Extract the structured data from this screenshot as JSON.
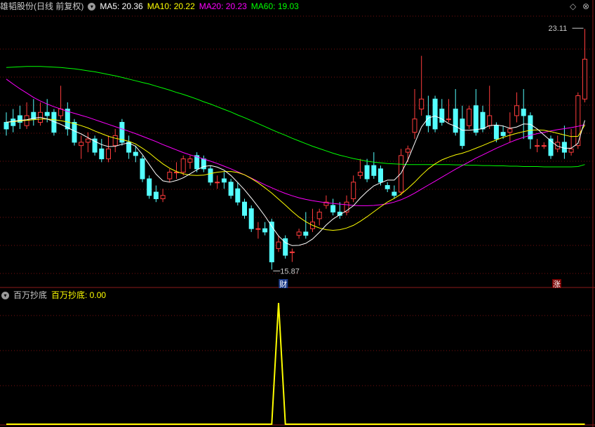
{
  "header": {
    "stock_name": "雄韬股份(日线 前复权)",
    "ma5_label": "MA5: 20.36",
    "ma10_label": "MA10: 20.22",
    "ma20_label": "MA20: 20.23",
    "ma60_label": "MA60: 19.03",
    "colors": {
      "ma5": "#ffffff",
      "ma10": "#ffff00",
      "ma20": "#ff00ff",
      "ma60": "#00ff00"
    }
  },
  "indicator": {
    "name": "百万抄底",
    "value_label": "百万抄底: 0.00"
  },
  "annotations": {
    "high_label": "23.11",
    "low_label": "15.87",
    "cai_marker": "财",
    "zhang_marker": "涨"
  },
  "controls": {
    "diamond": "◇",
    "close": "⊗"
  },
  "chart_data": [
    {
      "type": "candlestick",
      "y_range": [
        15.5,
        23.6
      ],
      "max_price": 23.11,
      "min_price": 15.87,
      "up_color": "#ff3c3c",
      "down_color": "#54ffff",
      "candles": [
        [
          20.3,
          20.1,
          20.6,
          19.9
        ],
        [
          20.4,
          20.2,
          20.7,
          20.0
        ],
        [
          20.5,
          20.3,
          20.8,
          20.1
        ],
        [
          20.2,
          20.5,
          20.9,
          20.1
        ],
        [
          20.6,
          20.4,
          21.0,
          20.2
        ],
        [
          20.3,
          20.6,
          20.9,
          20.2
        ],
        [
          20.6,
          20.5,
          21.0,
          20.3
        ],
        [
          20.6,
          20.0,
          20.7,
          19.9
        ],
        [
          20.5,
          20.7,
          21.4,
          20.4
        ],
        [
          20.7,
          20.1,
          20.9,
          19.9
        ],
        [
          20.3,
          19.7,
          20.4,
          19.6
        ],
        [
          19.6,
          19.7,
          19.9,
          19.2
        ],
        [
          19.7,
          19.8,
          20.0,
          19.4
        ],
        [
          19.8,
          19.4,
          19.9,
          19.3
        ],
        [
          19.5,
          19.2,
          19.8,
          19.1
        ],
        [
          19.2,
          19.5,
          19.9,
          19.1
        ],
        [
          19.6,
          19.9,
          20.1,
          19.4
        ],
        [
          20.3,
          19.7,
          20.4,
          19.6
        ],
        [
          19.7,
          19.4,
          19.9,
          19.2
        ],
        [
          19.4,
          19.3,
          19.6,
          19.1
        ],
        [
          19.2,
          18.6,
          19.3,
          18.5
        ],
        [
          18.6,
          18.1,
          18.7,
          18.0
        ],
        [
          18.2,
          18.0,
          18.4,
          17.9
        ],
        [
          18.0,
          18.1,
          18.3,
          17.9
        ],
        [
          18.6,
          18.8,
          18.9,
          18.5
        ],
        [
          18.8,
          18.8,
          19.1,
          18.6
        ],
        [
          18.8,
          19.2,
          19.3,
          18.7
        ],
        [
          19.1,
          19.2,
          19.3,
          18.9
        ],
        [
          19.3,
          18.9,
          19.4,
          18.8
        ],
        [
          19.2,
          18.9,
          19.3,
          18.8
        ],
        [
          18.9,
          18.5,
          19.0,
          18.4
        ],
        [
          18.5,
          18.5,
          18.7,
          18.3
        ],
        [
          18.6,
          18.5,
          18.8,
          18.3
        ],
        [
          18.5,
          18.1,
          18.6,
          18.0
        ],
        [
          18.3,
          17.9,
          18.5,
          17.8
        ],
        [
          17.9,
          17.5,
          18.0,
          17.4
        ],
        [
          17.7,
          17.1,
          17.8,
          17.0
        ],
        [
          17.1,
          17.1,
          17.3,
          16.8
        ],
        [
          17.1,
          17.0,
          17.3,
          16.9
        ],
        [
          17.3,
          16.1,
          17.4,
          15.87
        ],
        [
          16.5,
          16.7,
          16.9,
          16.4
        ],
        [
          16.8,
          16.3,
          16.9,
          16.2
        ],
        [
          16.4,
          16.4,
          16.5,
          16.1
        ],
        [
          16.9,
          17.0,
          17.1,
          16.8
        ],
        [
          17.0,
          16.9,
          17.6,
          16.8
        ],
        [
          17.1,
          17.3,
          17.7,
          17.0
        ],
        [
          17.4,
          17.6,
          17.7,
          17.2
        ],
        [
          17.8,
          17.9,
          18.1,
          17.7
        ],
        [
          17.8,
          17.6,
          18.0,
          17.5
        ],
        [
          17.6,
          17.5,
          17.9,
          17.4
        ],
        [
          17.6,
          17.9,
          18.1,
          17.5
        ],
        [
          18.0,
          18.5,
          18.7,
          17.9
        ],
        [
          18.7,
          18.8,
          19.2,
          18.6
        ],
        [
          19.0,
          18.6,
          19.2,
          18.5
        ],
        [
          19.0,
          18.7,
          19.4,
          18.6
        ],
        [
          18.9,
          18.5,
          19.0,
          18.4
        ],
        [
          18.4,
          18.3,
          18.5,
          18.2
        ],
        [
          18.2,
          18.1,
          18.4,
          18.0
        ],
        [
          18.2,
          19.3,
          19.5,
          18.1
        ],
        [
          19.4,
          19.5,
          19.6,
          19.1
        ],
        [
          20.0,
          20.4,
          21.3,
          19.8
        ],
        [
          20.7,
          21.0,
          22.3,
          20.5
        ],
        [
          20.5,
          20.2,
          21.1,
          20.0
        ],
        [
          21.0,
          20.1,
          21.1,
          20.0
        ],
        [
          20.7,
          20.3,
          21.0,
          20.2
        ],
        [
          20.4,
          20.4,
          21.0,
          20.3
        ],
        [
          20.7,
          20.0,
          21.3,
          19.9
        ],
        [
          20.4,
          19.6,
          20.8,
          19.5
        ],
        [
          20.2,
          20.7,
          20.8,
          20.1
        ],
        [
          20.8,
          20.0,
          21.3,
          19.9
        ],
        [
          20.6,
          20.1,
          20.8,
          20.0
        ],
        [
          20.2,
          20.5,
          21.4,
          20.1
        ],
        [
          20.2,
          19.8,
          20.3,
          19.7
        ],
        [
          20.0,
          19.9,
          20.2,
          19.8
        ],
        [
          20.0,
          20.1,
          20.6,
          19.7
        ],
        [
          20.5,
          20.8,
          21.2,
          20.3
        ],
        [
          20.7,
          20.5,
          21.3,
          19.8
        ],
        [
          20.5,
          19.8,
          20.6,
          19.5
        ],
        [
          19.6,
          19.6,
          19.8,
          19.4
        ],
        [
          19.6,
          19.6,
          19.7,
          19.5
        ],
        [
          19.8,
          19.3,
          19.9,
          19.2
        ],
        [
          19.5,
          19.7,
          19.9,
          19.4
        ],
        [
          19.7,
          19.4,
          20.2,
          19.2
        ],
        [
          19.4,
          19.5,
          20.1,
          19.3
        ],
        [
          19.6,
          21.1,
          21.2,
          19.5
        ],
        [
          21.0,
          22.2,
          23.11,
          20.9
        ]
      ],
      "ma5": [
        20.3,
        20.33,
        20.36,
        20.38,
        20.42,
        20.45,
        20.4,
        20.32,
        20.24,
        20.14,
        20.04,
        19.95,
        19.84,
        19.73,
        19.63,
        19.57,
        19.58,
        19.64,
        19.68,
        19.58,
        19.33,
        19.03,
        18.74,
        18.54,
        18.5,
        18.55,
        18.63,
        18.75,
        18.87,
        18.97,
        19.0,
        18.95,
        18.86,
        18.7,
        18.49,
        18.27,
        18.02,
        17.76,
        17.48,
        17.17,
        16.88,
        16.68,
        16.59,
        16.6,
        16.66,
        16.79,
        16.99,
        17.21,
        17.39,
        17.52,
        17.64,
        17.79,
        18.02,
        18.22,
        18.39,
        18.48,
        18.56,
        18.56,
        18.77,
        19.17,
        19.67,
        20.16,
        20.43,
        20.49,
        20.4,
        20.26,
        20.18,
        20.06,
        20.06,
        20.08,
        20.11,
        20.2,
        20.22,
        20.19,
        20.12,
        20.16,
        20.25,
        20.24,
        20.1,
        19.92,
        19.74,
        19.58,
        19.52,
        19.52,
        19.67,
        20.36
      ],
      "ma10": [
        20.3,
        20.32,
        20.34,
        20.36,
        20.38,
        20.4,
        20.4,
        20.38,
        20.35,
        20.31,
        20.26,
        20.2,
        20.13,
        20.04,
        19.96,
        19.88,
        19.82,
        19.78,
        19.73,
        19.65,
        19.52,
        19.38,
        19.21,
        19.05,
        18.92,
        18.82,
        18.75,
        18.71,
        18.7,
        18.71,
        18.76,
        18.8,
        18.82,
        18.82,
        18.79,
        18.72,
        18.61,
        18.48,
        18.33,
        18.17,
        17.99,
        17.81,
        17.62,
        17.45,
        17.31,
        17.2,
        17.12,
        17.07,
        17.05,
        17.07,
        17.12,
        17.2,
        17.32,
        17.46,
        17.61,
        17.76,
        17.9,
        18.01,
        18.14,
        18.31,
        18.5,
        18.71,
        18.9,
        19.05,
        19.17,
        19.25,
        19.32,
        19.37,
        19.44,
        19.52,
        19.6,
        19.69,
        19.77,
        19.85,
        19.91,
        19.97,
        20.02,
        20.06,
        20.07,
        20.06,
        20.02,
        19.97,
        19.92,
        19.87,
        19.88,
        20.22
      ],
      "ma20": [
        21.6,
        21.45,
        21.31,
        21.18,
        21.05,
        20.94,
        20.85,
        20.77,
        20.7,
        20.63,
        20.57,
        20.51,
        20.45,
        20.38,
        20.31,
        20.24,
        20.17,
        20.1,
        20.03,
        19.96,
        19.88,
        19.8,
        19.72,
        19.63,
        19.55,
        19.47,
        19.39,
        19.32,
        19.26,
        19.2,
        19.13,
        19.06,
        18.98,
        18.9,
        18.81,
        18.72,
        18.62,
        18.52,
        18.42,
        18.33,
        18.24,
        18.16,
        18.09,
        18.03,
        17.98,
        17.94,
        17.91,
        17.88,
        17.86,
        17.84,
        17.82,
        17.8,
        17.79,
        17.79,
        17.8,
        17.82,
        17.85,
        17.9,
        17.97,
        18.06,
        18.17,
        18.29,
        18.41,
        18.53,
        18.65,
        18.77,
        18.89,
        19.0,
        19.11,
        19.22,
        19.32,
        19.42,
        19.52,
        19.61,
        19.7,
        19.78,
        19.85,
        19.91,
        19.96,
        20.0,
        20.04,
        20.08,
        20.11,
        20.14,
        20.18,
        20.23
      ],
      "ma60": [
        21.95,
        21.96,
        21.97,
        21.98,
        21.98,
        21.98,
        21.97,
        21.96,
        21.95,
        21.93,
        21.91,
        21.88,
        21.85,
        21.82,
        21.78,
        21.74,
        21.7,
        21.65,
        21.6,
        21.55,
        21.5,
        21.45,
        21.39,
        21.33,
        21.27,
        21.2,
        21.14,
        21.07,
        21.0,
        20.92,
        20.85,
        20.77,
        20.69,
        20.61,
        20.52,
        20.44,
        20.35,
        20.26,
        20.17,
        20.08,
        19.99,
        19.91,
        19.82,
        19.74,
        19.66,
        19.58,
        19.51,
        19.44,
        19.37,
        19.31,
        19.26,
        19.21,
        19.17,
        19.13,
        19.1,
        19.08,
        19.06,
        19.05,
        19.04,
        19.03,
        19.03,
        19.03,
        19.03,
        19.03,
        19.03,
        19.03,
        19.02,
        19.02,
        19.01,
        19.01,
        19.0,
        19.0,
        18.99,
        18.99,
        18.98,
        18.98,
        18.97,
        18.97,
        18.97,
        18.96,
        18.96,
        18.96,
        18.96,
        18.96,
        18.97,
        19.03
      ]
    },
    {
      "type": "line",
      "series_name": "百万抄底",
      "color": "#ffff00",
      "y_range": [
        0,
        1
      ],
      "values": [
        0,
        0,
        0,
        0,
        0,
        0,
        0,
        0,
        0,
        0,
        0,
        0,
        0,
        0,
        0,
        0,
        0,
        0,
        0,
        0,
        0,
        0,
        0,
        0,
        0,
        0,
        0,
        0,
        0,
        0,
        0,
        0,
        0,
        0,
        0,
        0,
        0,
        0,
        0,
        0,
        1,
        0,
        0,
        0,
        0,
        0,
        0,
        0,
        0,
        0,
        0,
        0,
        0,
        0,
        0,
        0,
        0,
        0,
        0,
        0,
        0,
        0,
        0,
        0,
        0,
        0,
        0,
        0,
        0,
        0,
        0,
        0,
        0,
        0,
        0,
        0,
        0,
        0,
        0,
        0,
        0,
        0,
        0,
        0,
        0,
        0
      ]
    }
  ]
}
